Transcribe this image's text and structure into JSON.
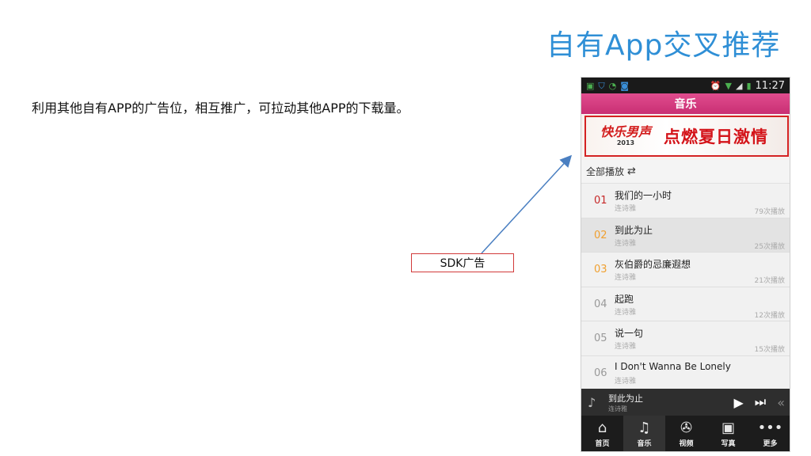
{
  "slide": {
    "title": "自有App交叉推荐",
    "description": "利用其他自有APP的广告位，相互推广，可拉动其他APP的下载量。",
    "sdk_label": "SDK广告"
  },
  "phone": {
    "status_bar": {
      "time": "11:27"
    },
    "header_title": "音乐",
    "banner": {
      "logo_text": "快乐男声",
      "logo_sub": "2013",
      "slogan": "点燃夏日激情"
    },
    "playall": {
      "label": "全部播放"
    },
    "songs": [
      {
        "num": "01",
        "title": "我们的一小时",
        "artist": "连诗雅",
        "plays": "79次播放"
      },
      {
        "num": "02",
        "title": "到此为止",
        "artist": "连诗雅",
        "plays": "25次播放"
      },
      {
        "num": "03",
        "title": "灰伯爵的忌廉遐想",
        "artist": "连诗雅",
        "plays": "21次播放"
      },
      {
        "num": "04",
        "title": "起跑",
        "artist": "连诗雅",
        "plays": "12次播放"
      },
      {
        "num": "05",
        "title": "说一句",
        "artist": "连诗雅",
        "plays": "15次播放"
      },
      {
        "num": "06",
        "title": "I Don't Wanna Be Lonely",
        "artist": "连诗雅",
        "plays": ""
      }
    ],
    "mini_player": {
      "title": "到此为止",
      "artist": "连诗雅"
    },
    "nav": [
      {
        "label": "首页",
        "icon": "home-icon"
      },
      {
        "label": "音乐",
        "icon": "music-icon"
      },
      {
        "label": "视频",
        "icon": "video-icon"
      },
      {
        "label": "写真",
        "icon": "photo-icon"
      },
      {
        "label": "更多",
        "icon": "more-icon"
      }
    ],
    "colors": {
      "header": "#d63c80",
      "banner_border": "#d42222",
      "title_blue": "#2f8fd6"
    }
  }
}
